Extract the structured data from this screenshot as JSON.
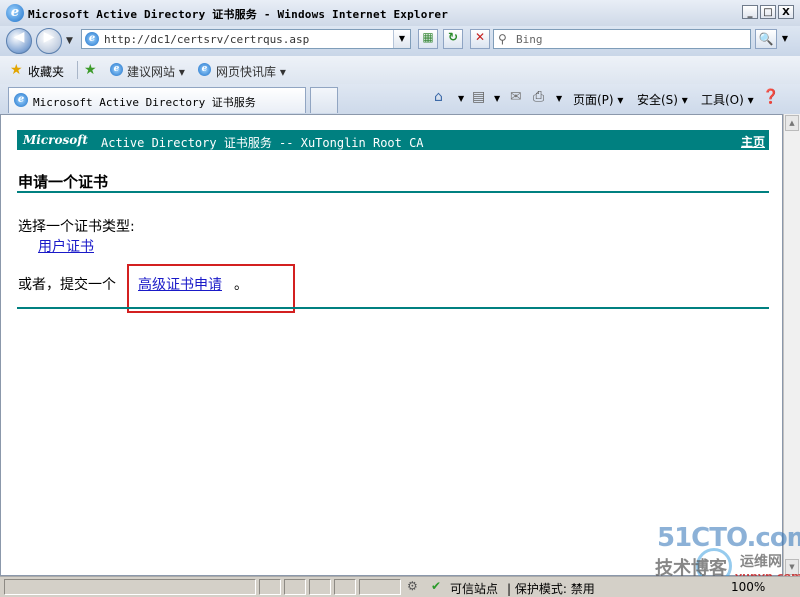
{
  "window": {
    "title": "Microsoft Active Directory 证书服务 - Windows Internet Explorer",
    "minimize": "_",
    "maximize": "□",
    "close": "X"
  },
  "address": {
    "url": "http://dc1/certsrv/certrqus.asp",
    "search_placeholder": "Bing"
  },
  "favorites": {
    "label": "收藏夹",
    "links": [
      "建议网站 ▾",
      "网页快讯库 ▾"
    ]
  },
  "tab": {
    "title": "Microsoft Active Directory 证书服务"
  },
  "commandbar": {
    "page": "页面(P) ▾",
    "safety": "安全(S) ▾",
    "tools": "工具(O) ▾"
  },
  "page": {
    "banner_brand": "Microsoft",
    "banner_rest": "Active Directory 证书服务  --  XuTonglin Root CA",
    "home_link": "主页",
    "heading": "申请一个证书",
    "choose_type": "选择一个证书类型:",
    "user_cert_link": "用户证书",
    "or_submit": "或者，提交一个",
    "advanced_link": "高级证书申请",
    "advanced_suffix": "。"
  },
  "status": {
    "zone": "可信站点",
    "protected_mode": "| 保护模式: 禁用",
    "zoom": "100%"
  },
  "watermark": {
    "line1": "51CTO.com",
    "line2": "技术博客",
    "line3": "yunvn.com",
    "line4": "运维网"
  },
  "colors": {
    "banner": "#008080",
    "link": "#1a1ac8",
    "highlight_box": "#d32020"
  }
}
